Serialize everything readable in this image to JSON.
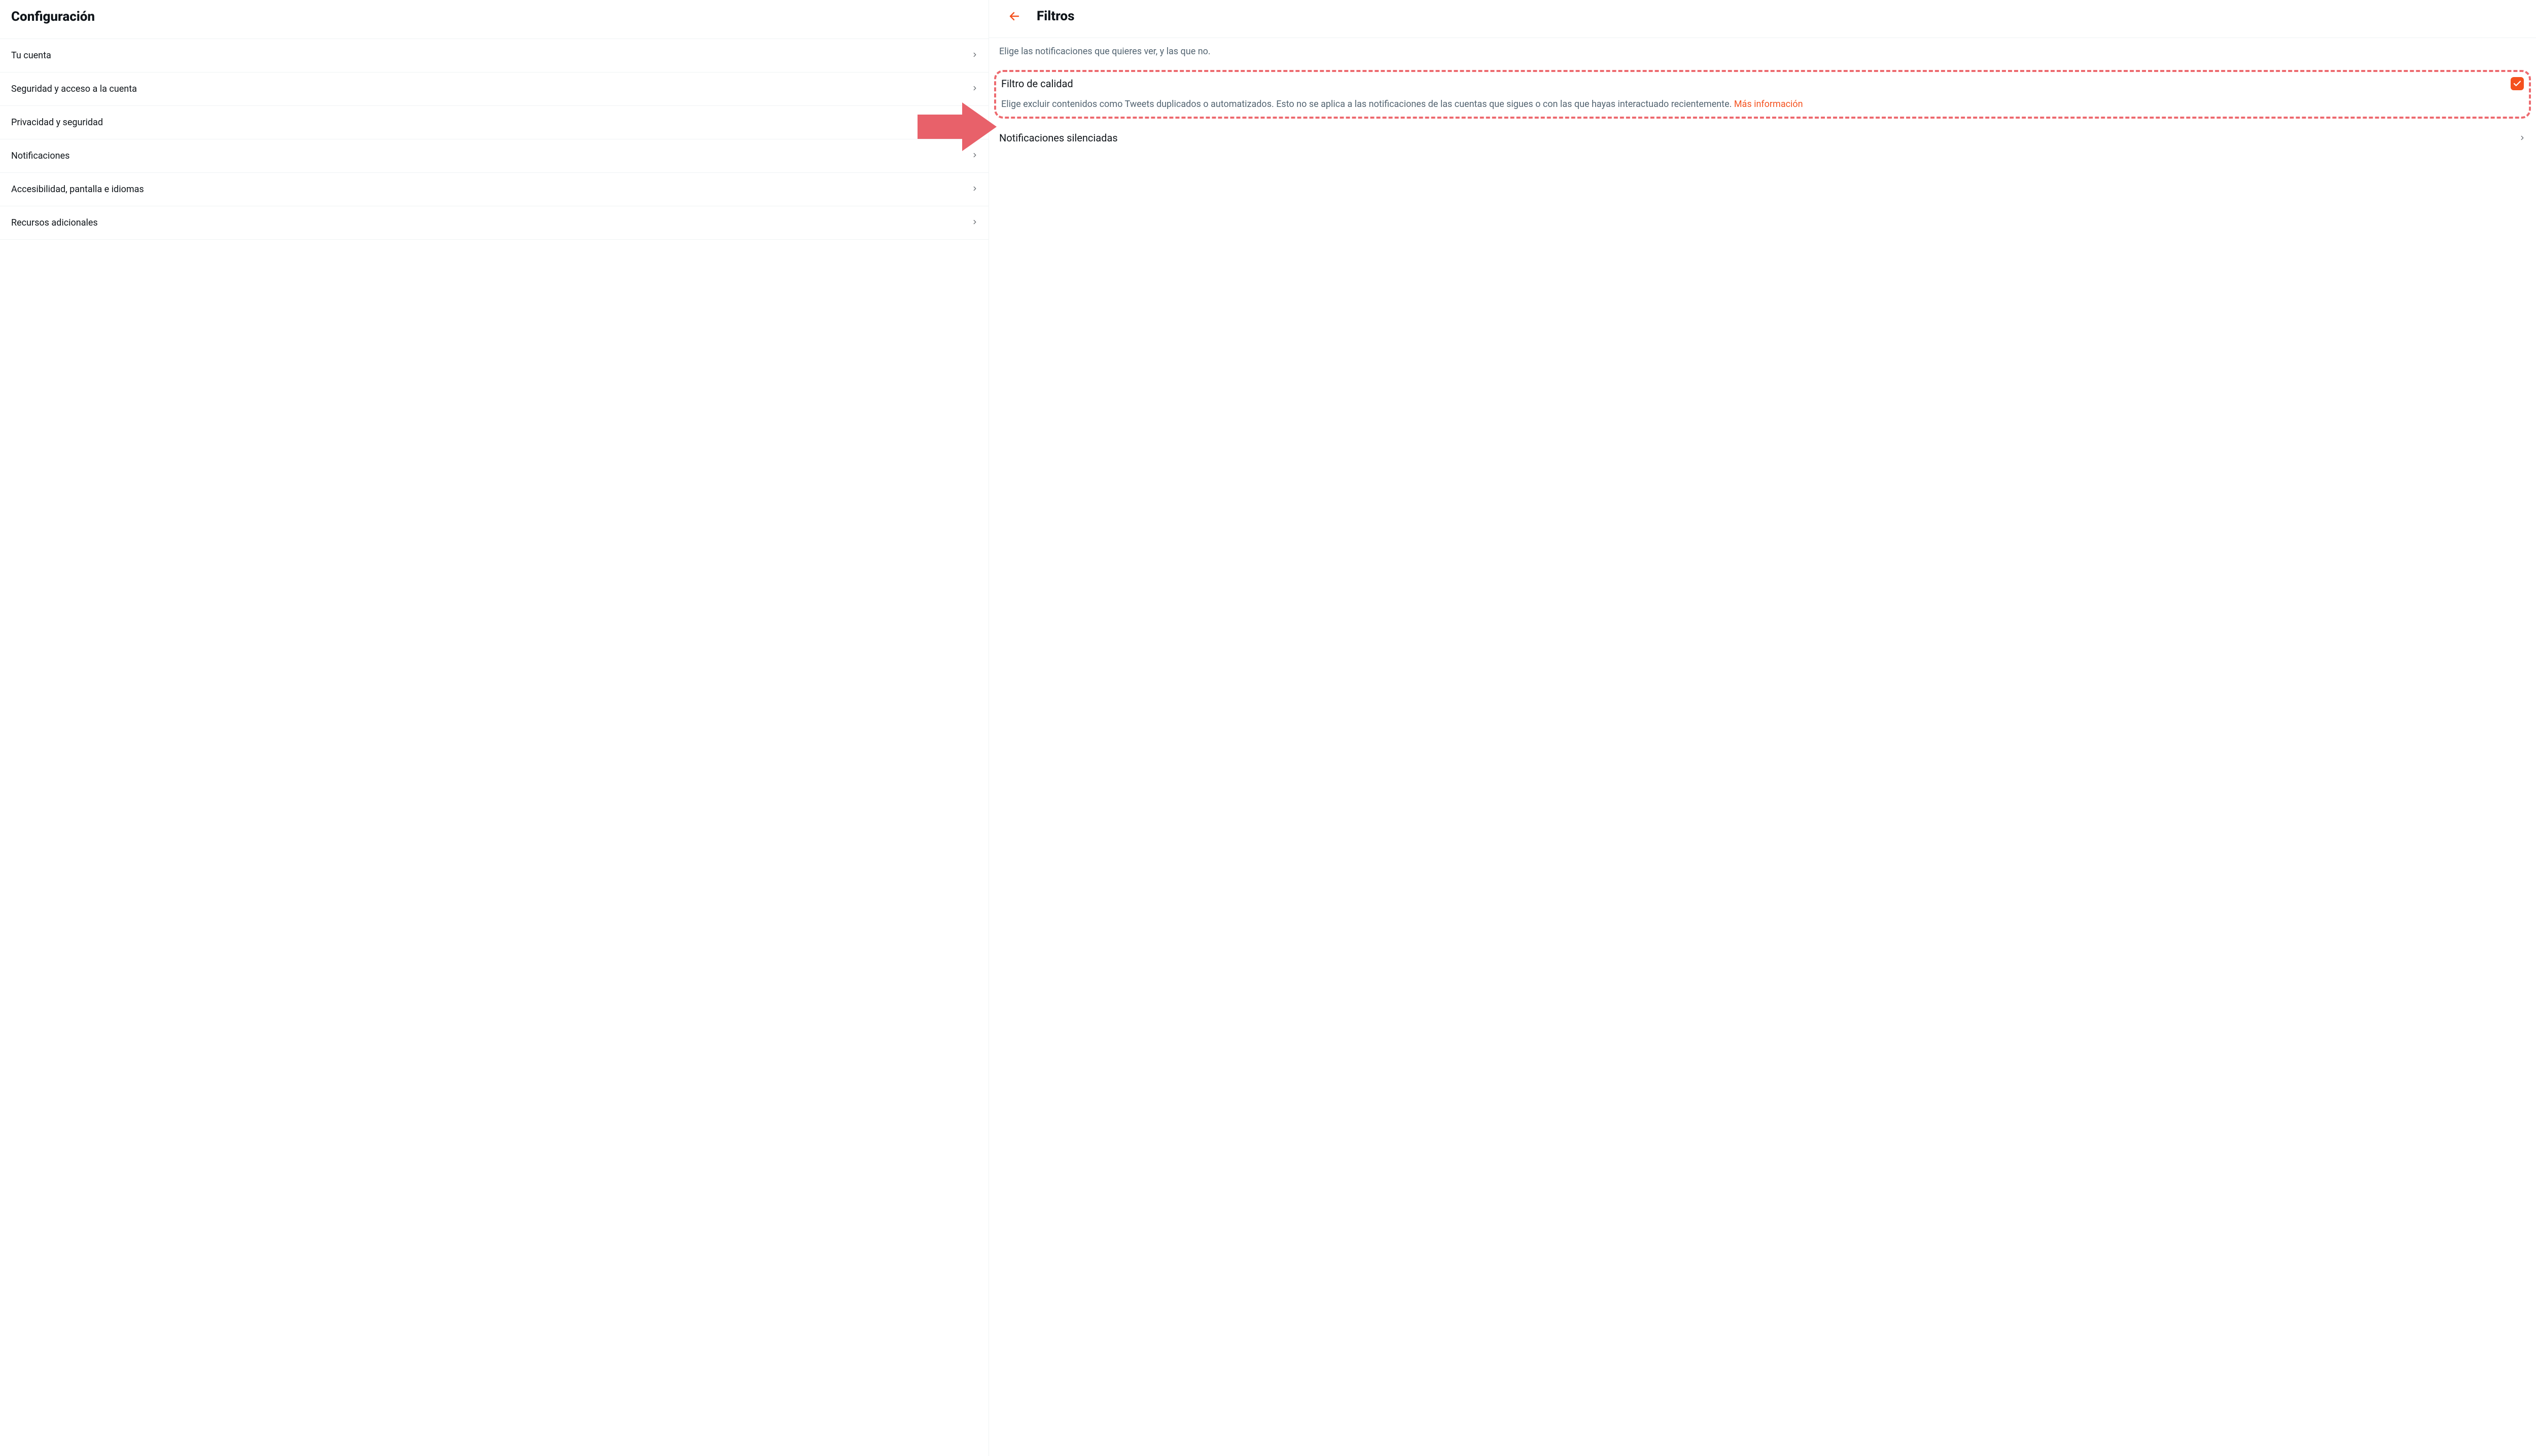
{
  "sidebar": {
    "title": "Configuración",
    "items": [
      {
        "label": "Tu cuenta"
      },
      {
        "label": "Seguridad y acceso a la cuenta"
      },
      {
        "label": "Privacidad y seguridad"
      },
      {
        "label": "Notificaciones"
      },
      {
        "label": "Accesibilidad, pantalla e idiomas"
      },
      {
        "label": "Recursos adicionales"
      }
    ]
  },
  "detail": {
    "title": "Filtros",
    "intro": "Elige las notificaciones que quieres ver, y las que no.",
    "quality_filter": {
      "title": "Filtro de calidad",
      "checked": true,
      "description": "Elige excluir contenidos como Tweets duplicados o automatizados. Esto no se aplica a las notificaciones de las cuentas que sigues o con las que hayas interactuado recientemente. ",
      "learn_more": "Más información"
    },
    "muted_row": "Notificaciones silenciadas"
  },
  "colors": {
    "accent": "#f4511e",
    "annotation": "#ed6a6f",
    "muted_text": "#536471",
    "border": "#eff3f4"
  }
}
